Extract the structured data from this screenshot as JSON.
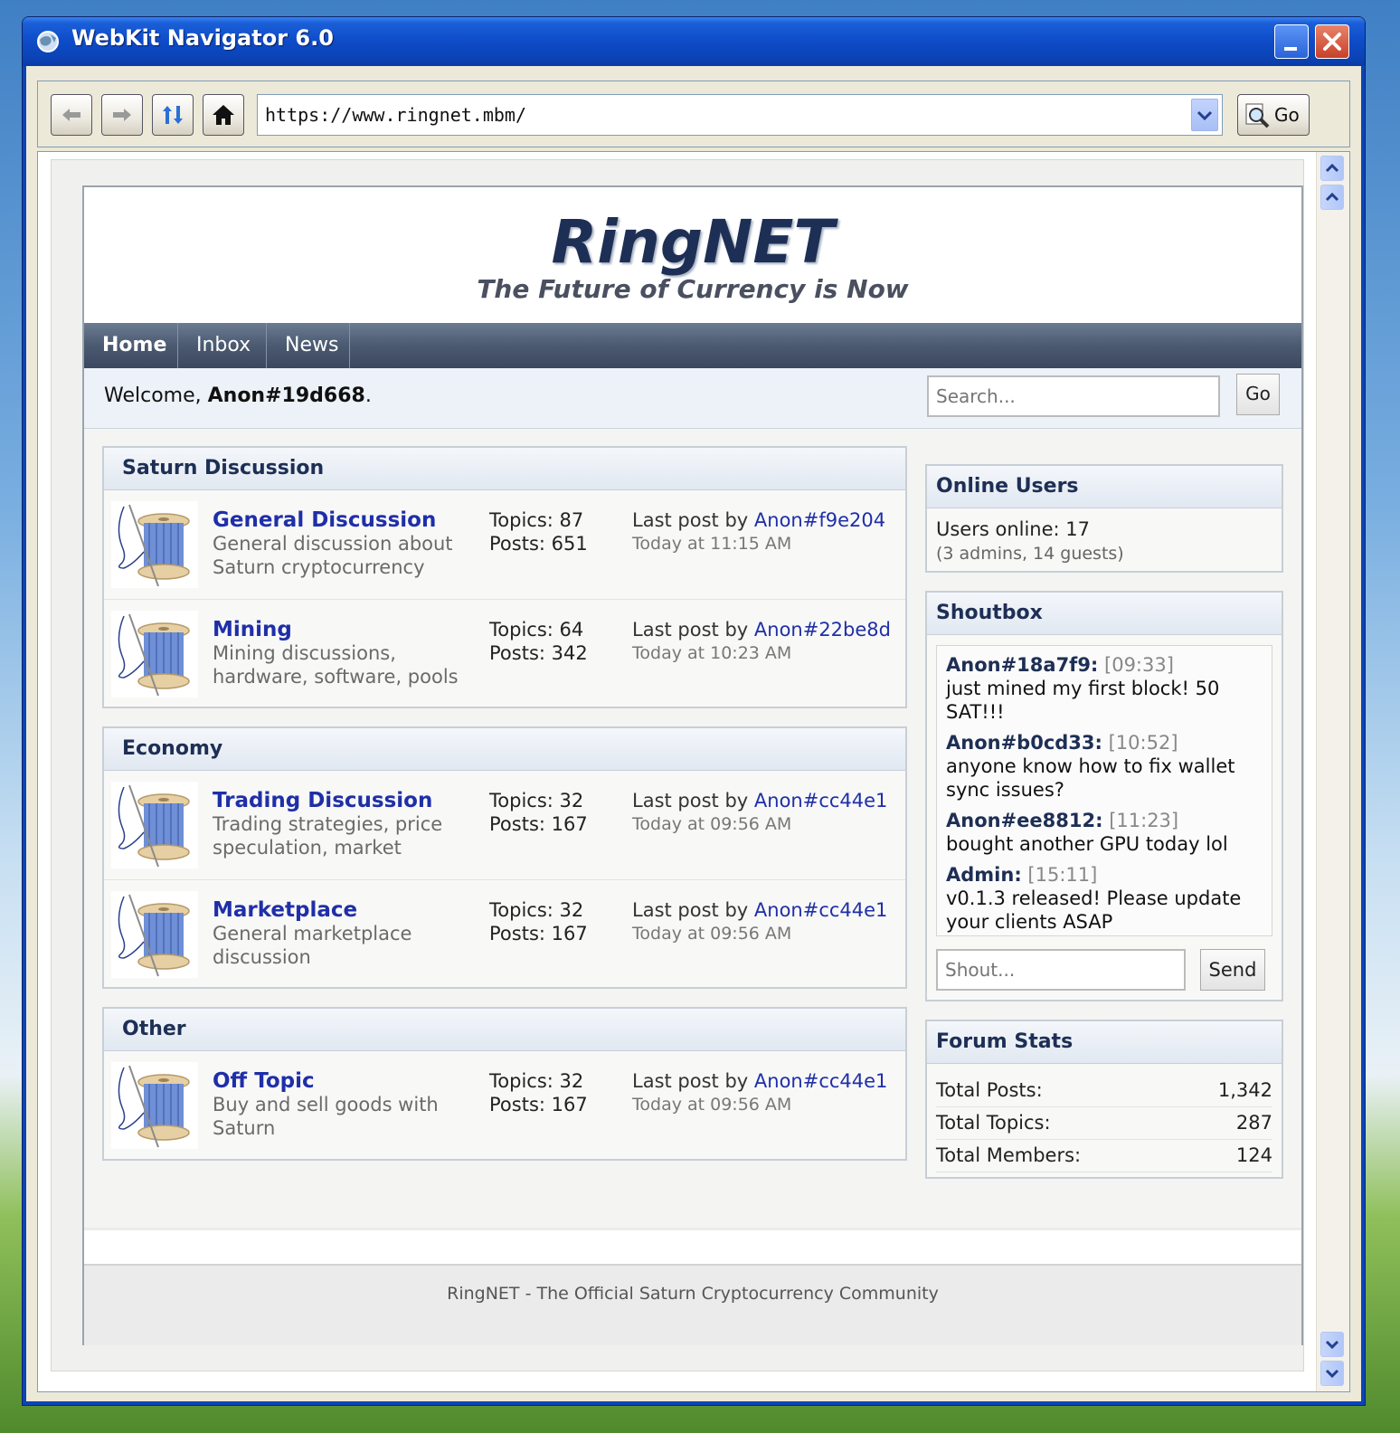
{
  "window": {
    "title": "WebKit Navigator 6.0"
  },
  "toolbar": {
    "url": "https://www.ringnet.mbm/",
    "go_label": "Go"
  },
  "site": {
    "logo": "RingNET",
    "tagline": "The Future of Currency is Now",
    "nav": {
      "home": "Home",
      "inbox": "Inbox",
      "news": "News"
    },
    "welcome_prefix": "Welcome, ",
    "welcome_user": "Anon#19d668",
    "welcome_suffix": ".",
    "search_placeholder": "Search...",
    "search_go": "Go"
  },
  "categories": [
    {
      "name": "Saturn Discussion",
      "forums": [
        {
          "title": "General Discussion",
          "desc": "General discussion about Saturn cryptocurrency",
          "topics": "Topics: 87",
          "posts": "Posts: 651",
          "last_prefix": "Last post by ",
          "last_user": "Anon#f9e204",
          "last_time": "Today at 11:15 AM"
        },
        {
          "title": "Mining",
          "desc": "Mining discussions, hardware, software, pools",
          "topics": "Topics: 64",
          "posts": "Posts: 342",
          "last_prefix": "Last post by ",
          "last_user": "Anon#22be8d",
          "last_time": "Today at 10:23 AM"
        }
      ]
    },
    {
      "name": "Economy",
      "forums": [
        {
          "title": "Trading Discussion",
          "desc": "Trading strategies, price speculation, market",
          "topics": "Topics: 32",
          "posts": "Posts: 167",
          "last_prefix": "Last post by ",
          "last_user": "Anon#cc44e1",
          "last_time": "Today at 09:56 AM"
        },
        {
          "title": "Marketplace",
          "desc": "General marketplace discussion",
          "topics": "Topics: 32",
          "posts": "Posts: 167",
          "last_prefix": "Last post by ",
          "last_user": "Anon#cc44e1",
          "last_time": "Today at 09:56 AM"
        }
      ]
    },
    {
      "name": "Other",
      "forums": [
        {
          "title": "Off Topic",
          "desc": "Buy and sell goods with Saturn",
          "topics": "Topics: 32",
          "posts": "Posts: 167",
          "last_prefix": "Last post by ",
          "last_user": "Anon#cc44e1",
          "last_time": "Today at 09:56 AM"
        }
      ]
    }
  ],
  "online": {
    "title": "Online Users",
    "line1": "Users online: 17",
    "line2": "(3 admins, 14 guests)"
  },
  "shoutbox": {
    "title": "Shoutbox",
    "messages": [
      {
        "name": "Anon#18a7f9:",
        "time": "[09:33]",
        "text": "just mined my first block! 50 SAT!!!"
      },
      {
        "name": "Anon#b0cd33:",
        "time": "[10:52]",
        "text": "anyone know how to fix wallet sync issues?"
      },
      {
        "name": "Anon#ee8812:",
        "time": "[11:23]",
        "text": "bought another GPU today lol"
      },
      {
        "name": "Admin:",
        "time": "[15:11]",
        "text": "v0.1.3 released! Please update your clients ASAP"
      }
    ],
    "placeholder": "Shout...",
    "send": "Send"
  },
  "stats": {
    "title": "Forum Stats",
    "rows": [
      {
        "label": "Total Posts:",
        "value": "1,342"
      },
      {
        "label": "Total Topics:",
        "value": "287"
      },
      {
        "label": "Total Members:",
        "value": "124"
      }
    ]
  },
  "footer": "RingNET - The Official Saturn Cryptocurrency Community"
}
